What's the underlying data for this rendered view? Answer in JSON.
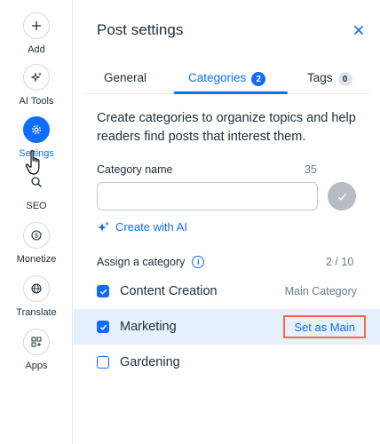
{
  "rail": {
    "items": [
      {
        "label": "Add",
        "icon": "plus-icon",
        "active": false
      },
      {
        "label": "AI Tools",
        "icon": "sparkle-icon",
        "active": false
      },
      {
        "label": "Settings",
        "icon": "gear-icon",
        "active": true
      },
      {
        "label": "SEO",
        "icon": "search-icon",
        "active": false
      },
      {
        "label": "Monetize",
        "icon": "dollar-icon",
        "active": false
      },
      {
        "label": "Translate",
        "icon": "globe-icon",
        "active": false
      },
      {
        "label": "Apps",
        "icon": "apps-grid-icon",
        "active": false
      }
    ]
  },
  "panel": {
    "title": "Post settings",
    "tabs": [
      {
        "label": "General",
        "badge": ""
      },
      {
        "label": "Categories",
        "badge": "2"
      },
      {
        "label": "Tags",
        "badge": "0"
      }
    ],
    "active_tab": "Categories",
    "description": "Create categories to organize topics and help readers find posts that interest them.",
    "category_name_label": "Category name",
    "char_limit": "35",
    "category_input_value": "",
    "create_ai_label": "Create with AI",
    "assign_label": "Assign a category",
    "assign_count": "2 / 10",
    "categories": [
      {
        "name": "Content Creation",
        "checked": true,
        "tag": "Main Category"
      },
      {
        "name": "Marketing",
        "checked": true,
        "action": "Set as Main"
      },
      {
        "name": "Gardening",
        "checked": false
      }
    ]
  },
  "colors": {
    "accent": "#116dff",
    "highlight_row": "#e7f0ff",
    "callout_border": "#ff6a3d",
    "confirm_disabled": "#b6bcc4"
  }
}
